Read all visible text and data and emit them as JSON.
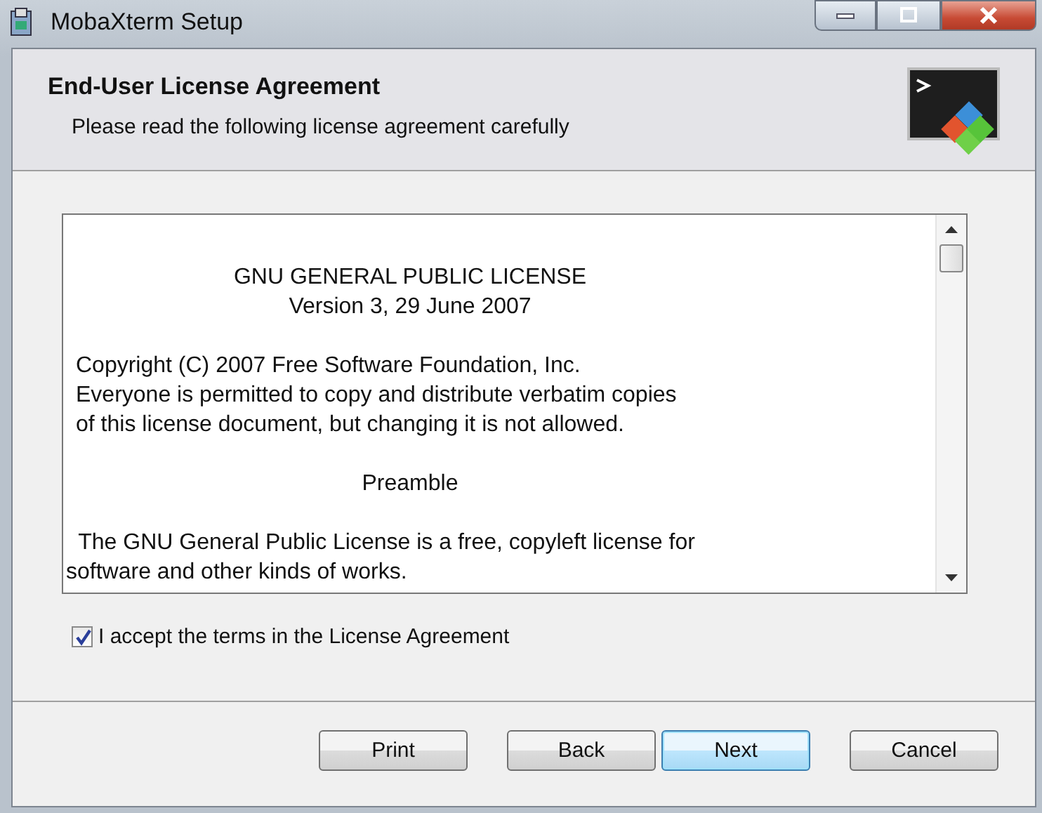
{
  "window": {
    "title": "MobaXterm Setup"
  },
  "header": {
    "title": "End-User License Agreement",
    "subtitle": "Please read the following license agreement carefully"
  },
  "license": {
    "paragraphs": [
      {
        "kind": "centered",
        "lines": [
          "GNU GENERAL PUBLIC LICENSE",
          "Version 3, 29 June 2007"
        ]
      },
      {
        "kind": "left",
        "lines": [
          "Copyright (C) 2007 Free Software Foundation, Inc.",
          "Everyone is permitted to copy and distribute verbatim copies",
          "of this license document, but changing it is not allowed."
        ]
      },
      {
        "kind": "centered",
        "lines": [
          "Preamble"
        ]
      },
      {
        "kind": "flush",
        "lines": [
          "  The GNU General Public License is a free, copyleft license for",
          "software and other kinds of works."
        ]
      }
    ]
  },
  "accept": {
    "label": "I accept the terms in the License Agreement",
    "checked": true
  },
  "buttons": [
    {
      "label": "Print",
      "default": false
    },
    {
      "label": "Back",
      "default": false
    },
    {
      "label": "Next",
      "default": true
    },
    {
      "label": "Cancel",
      "default": false
    }
  ]
}
